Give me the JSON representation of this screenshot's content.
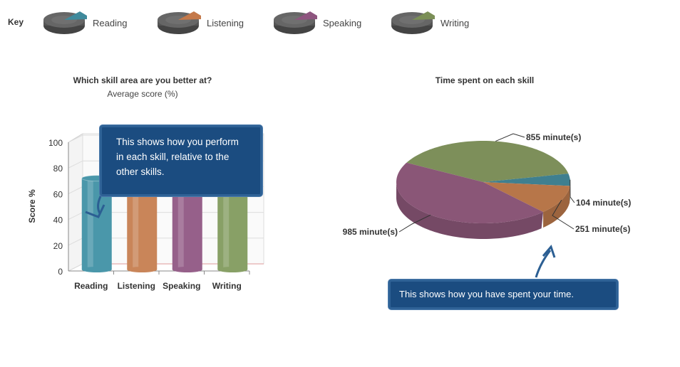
{
  "key": {
    "label": "Key",
    "items": [
      {
        "label": "Reading",
        "color": "#3f8a9c"
      },
      {
        "label": "Listening",
        "color": "#c4794a"
      },
      {
        "label": "Speaking",
        "color": "#8e557f"
      },
      {
        "label": "Writing",
        "color": "#7b8f57"
      }
    ]
  },
  "chart_data": [
    {
      "type": "bar",
      "title": "Which skill area are you better at?",
      "subtitle": "Average score (%)",
      "ylabel": "Score %",
      "ylim": [
        0,
        100
      ],
      "yticks": [
        "0",
        "20",
        "40",
        "60",
        "80",
        "100"
      ],
      "categories": [
        "Reading",
        "Listening",
        "Speaking",
        "Writing"
      ],
      "values": [
        72,
        70,
        69,
        70
      ],
      "colors": [
        "#4a97aa",
        "#c98559",
        "#96608a",
        "#88a066"
      ]
    },
    {
      "type": "pie",
      "title": "Time spent on each skill",
      "slices": [
        {
          "name": "Writing",
          "value": 855,
          "label": "855 minute(s)",
          "color": "#7d8f5a"
        },
        {
          "name": "Reading",
          "value": 104,
          "label": "104 minute(s)",
          "color": "#3f7f8f"
        },
        {
          "name": "Listening",
          "value": 251,
          "label": "251 minute(s)",
          "color": "#b77649"
        },
        {
          "name": "Speaking",
          "value": 985,
          "label": "985 minute(s)",
          "color": "#8a5677"
        }
      ]
    }
  ],
  "callouts": {
    "bar": "This shows how you perform in each skill, relative to the other skills.",
    "pie": "This shows how you have spent your time."
  }
}
